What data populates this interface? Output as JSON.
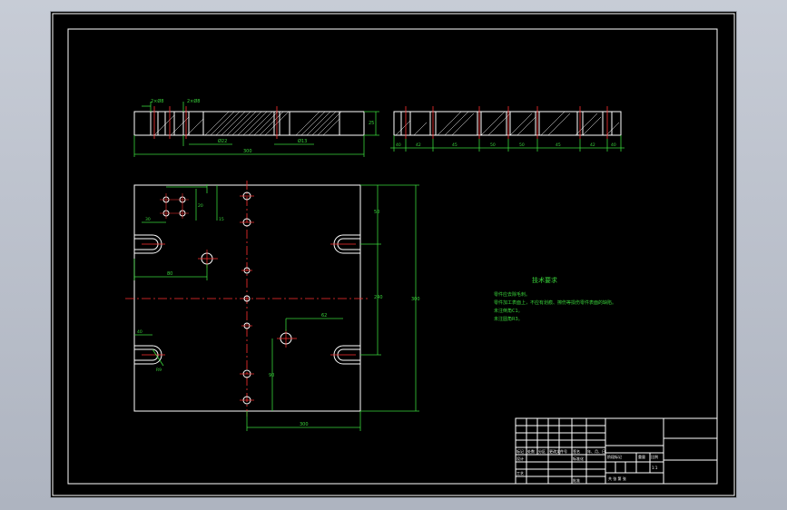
{
  "drawing": {
    "tech_requirements": {
      "title": "技术要求",
      "lines": [
        "零件应去除毛刺。",
        "零件加工表面上，不应有划痕、擦伤等损伤零件表面的缺陷。",
        "未注倒角C1。",
        "未注圆角R3。"
      ]
    },
    "dims": {
      "front_width": "300",
      "front_d1": "Ø22",
      "front_d2": "Ø13",
      "front_h": "25",
      "top_tag1": "2×Ø8",
      "top_tag2": "2×Ø8",
      "side_d1": "40",
      "side_d2": "42",
      "side_d3": "45",
      "side_d4": "50",
      "side_d5": "50",
      "side_d6": "45",
      "side_d7": "42",
      "side_d8": "40",
      "plan_h": "300",
      "plan_h2": "240",
      "plan_v1": "50",
      "plan_w": "300",
      "plan_a": "30",
      "plan_b": "80",
      "plan_c": "15",
      "plan_d": "20",
      "plan_e": "62",
      "plan_f": "90",
      "plan_g": "40",
      "plan_r": "R9"
    },
    "title_block": {
      "row_labels": [
        "标记",
        "处数",
        "分区",
        "更改文件号",
        "签名",
        "年、月、日"
      ],
      "design": "设计",
      "standard": "标准化",
      "process": "工艺",
      "approve": "批准",
      "stage": "阶段标记",
      "weight": "重量",
      "scale": "比例",
      "scale_value": "1:1",
      "sheet": "共    张    第    张"
    }
  }
}
